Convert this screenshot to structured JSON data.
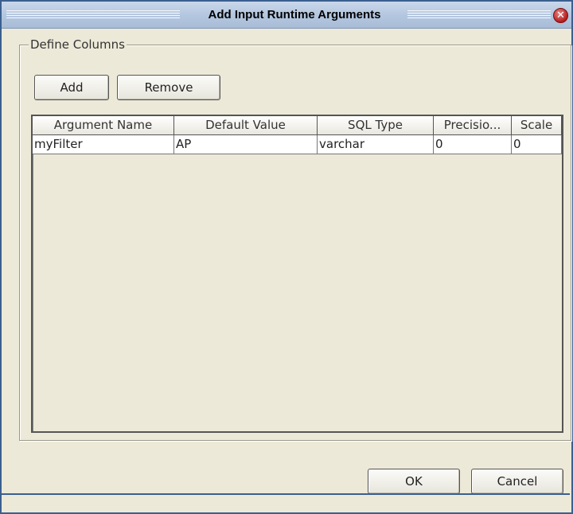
{
  "dialog": {
    "title": "Add Input Runtime Arguments",
    "close_glyph": "✕"
  },
  "group": {
    "legend": "Define Columns"
  },
  "buttons": {
    "add": "Add",
    "remove": "Remove",
    "ok": "OK",
    "cancel": "Cancel"
  },
  "table": {
    "columns": [
      "Argument Name",
      "Default Value",
      "SQL Type",
      "Precisio...",
      "Scale"
    ],
    "rows": [
      [
        "myFilter",
        "AP",
        "varchar",
        "0",
        "0"
      ]
    ]
  },
  "icons": {
    "close": "close-icon"
  },
  "colors": {
    "titlebar": "#b3c6df",
    "window_bg": "#ece9d8",
    "close_button": "#b51b1b"
  }
}
